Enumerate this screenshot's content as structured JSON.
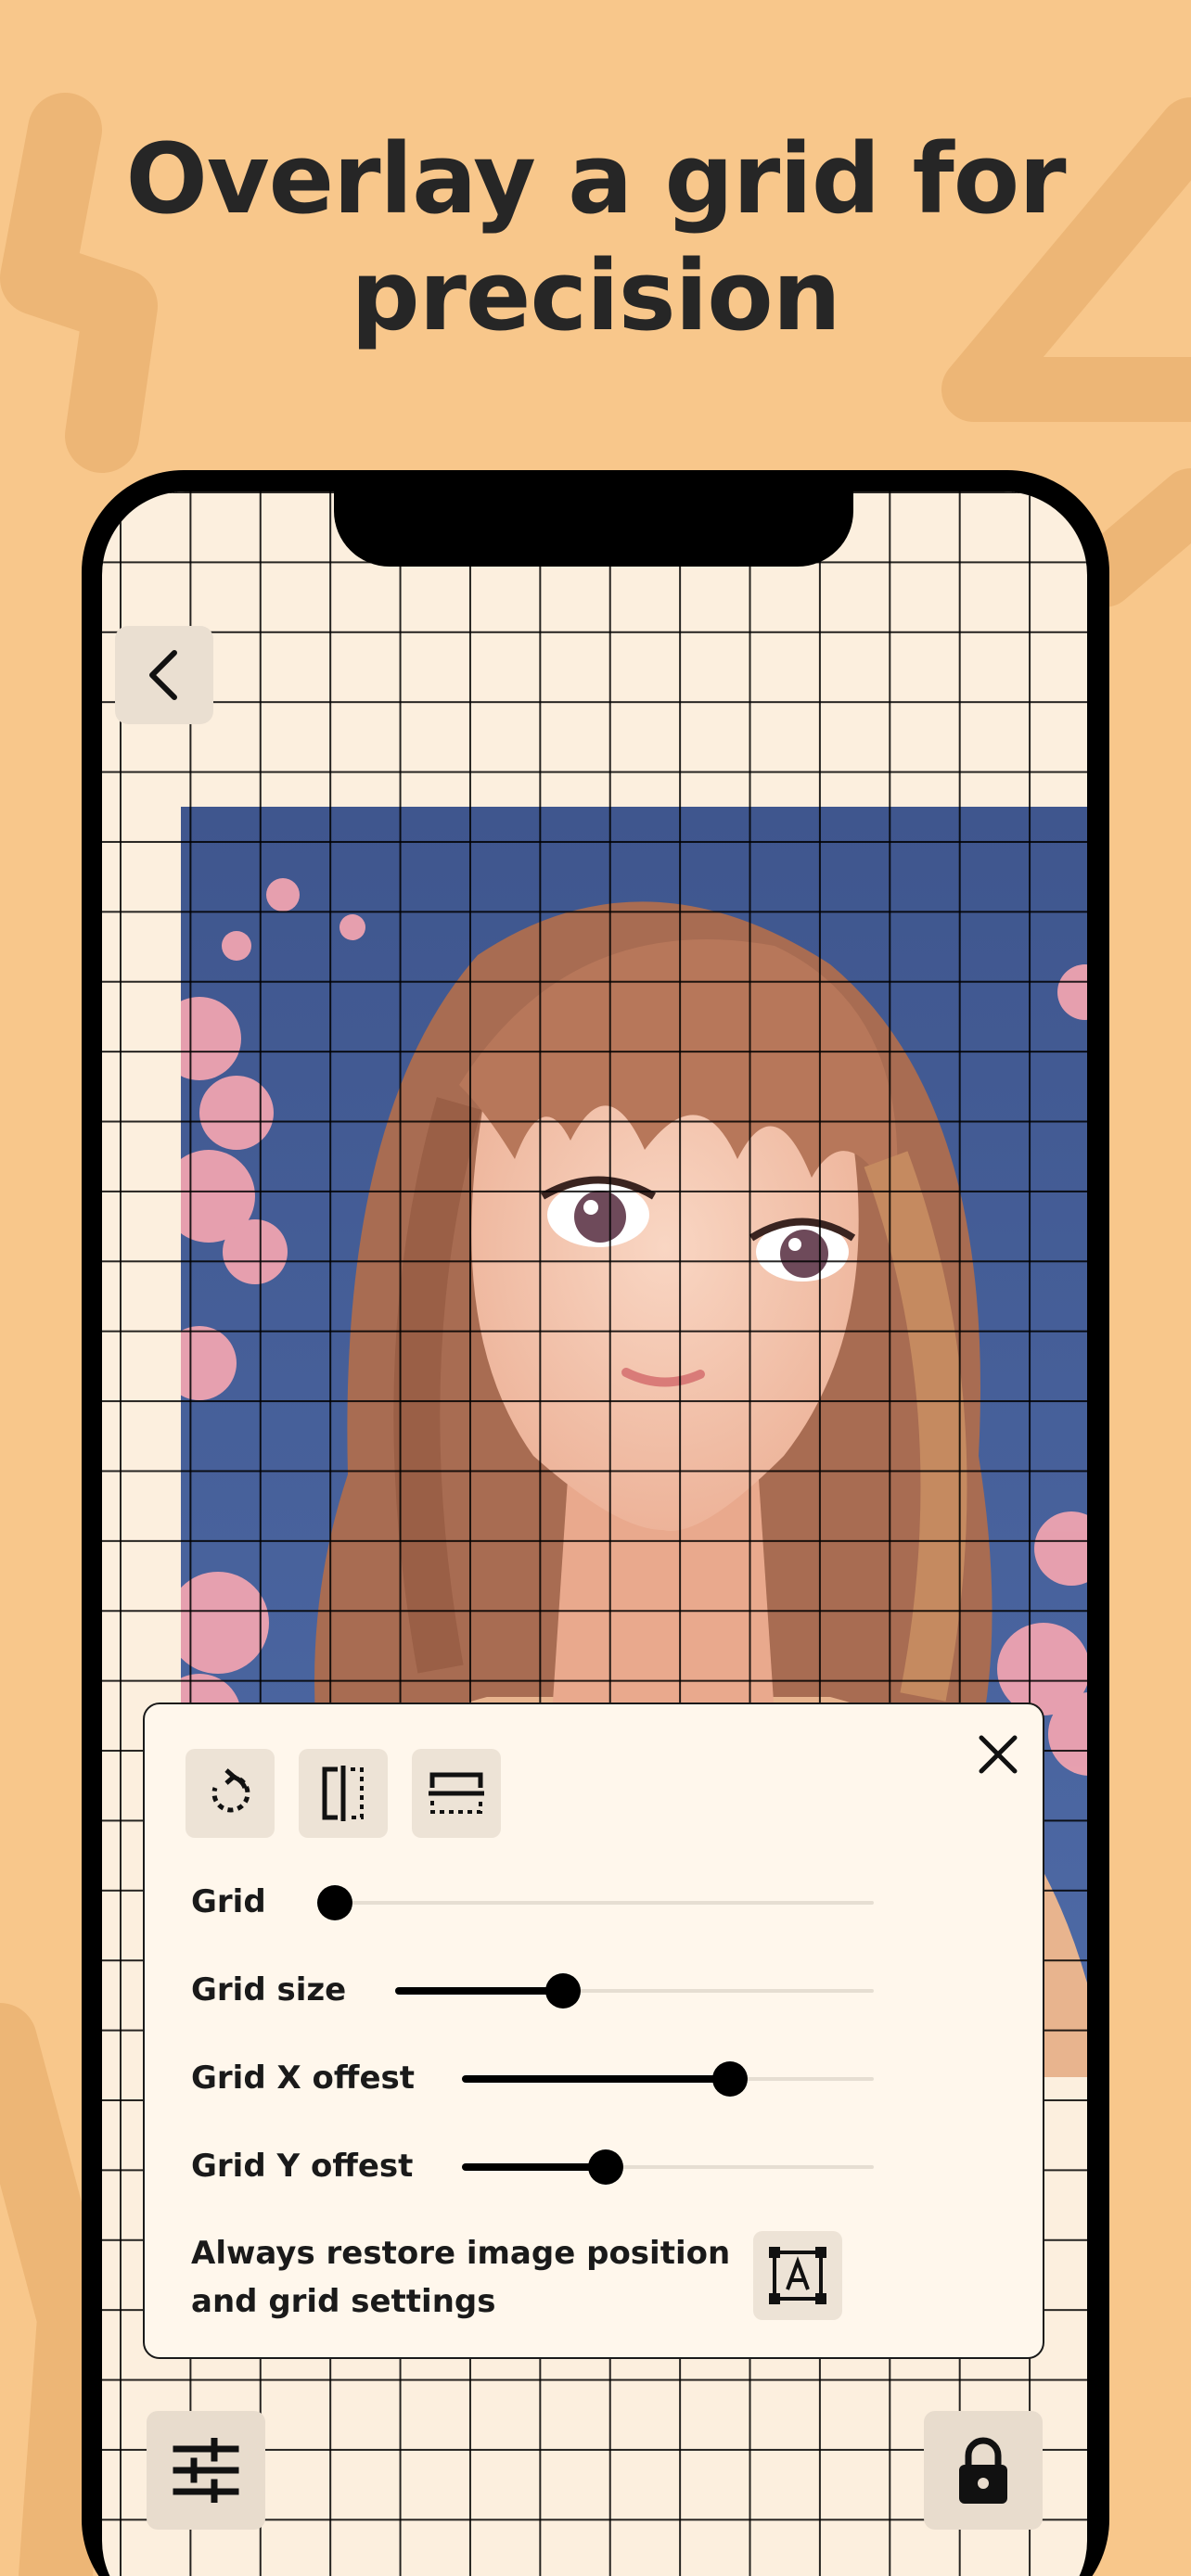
{
  "promo": {
    "headline_line1": "Overlay a grid for",
    "headline_line2": "precision"
  },
  "colors": {
    "background": "#F8C78B",
    "screen": "#FCEFDE",
    "panel": "#FFF7EC",
    "accent": "#000000"
  },
  "toolbar": {
    "back_icon": "chevron-left-icon",
    "tools": [
      {
        "name": "rotate",
        "icon": "rotate-icon"
      },
      {
        "name": "flip-horizontal",
        "icon": "flip-horizontal-icon"
      },
      {
        "name": "flip-vertical",
        "icon": "flip-vertical-icon"
      }
    ],
    "close_icon": "close-icon"
  },
  "grid_settings": {
    "grid": {
      "label": "Grid",
      "value": 0.0
    },
    "grid_size": {
      "label": "Grid size",
      "value": 0.35
    },
    "grid_x_offset": {
      "label": "Grid X offest",
      "value": 0.65
    },
    "grid_y_offset": {
      "label": "Grid Y offest",
      "value": 0.35
    }
  },
  "restore": {
    "line1": "Always restore image position",
    "line2": "and grid settings",
    "icon": "text-frame-icon"
  },
  "bottom_bar": {
    "settings_icon": "sliders-icon",
    "lock_icon": "lock-icon"
  }
}
